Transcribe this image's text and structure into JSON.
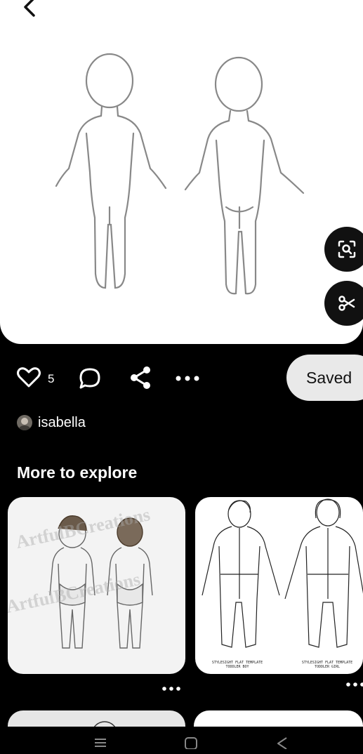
{
  "pin": {
    "like_count": "5",
    "saved_label": "Saved",
    "author_name": "isabella"
  },
  "explore": {
    "title": "More to explore",
    "cards": [
      {
        "watermark": "ArtfulBCreations"
      },
      {
        "caption_left": "STYLESIGHT FLAT TEMPLATE\nTODDLER BOY",
        "caption_right": "STYLESIGHT FLAT TEMPLATE\nTODDLER GIRL"
      }
    ]
  },
  "icons": {
    "back": "chevron-left-icon",
    "lens": "visual-search-icon",
    "cut": "scissors-icon",
    "heart": "heart-icon",
    "comment": "comment-icon",
    "share": "share-icon",
    "more": "more-dots-icon",
    "nav_recent": "recent-apps-icon",
    "nav_home": "home-icon",
    "nav_back": "back-triangle-icon"
  },
  "colors": {
    "background": "#000000",
    "saved_button": "#e9e9e9",
    "hero": "#ffffff"
  }
}
